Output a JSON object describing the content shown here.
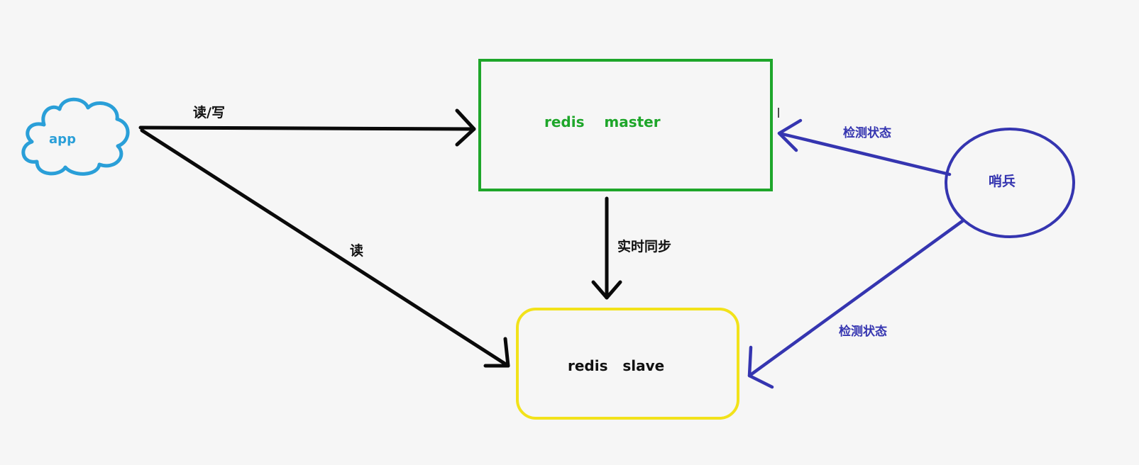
{
  "nodes": {
    "app": {
      "label": "app"
    },
    "master": {
      "label": "redis    master"
    },
    "slave": {
      "label": "redis   slave"
    },
    "sentinel": {
      "label": "哨兵"
    }
  },
  "edges": {
    "app_master": {
      "label": "读/写"
    },
    "app_slave": {
      "label": "读"
    },
    "master_slave": {
      "label": "实时同步"
    },
    "sentinel_master": {
      "label": "检测状态"
    },
    "sentinel_slave": {
      "label": "检测状态"
    }
  },
  "cursor": {
    "glyph": "I"
  },
  "colors": {
    "cloud": "#2a9fd8",
    "master": "#1ea62a",
    "slave": "#f2e21a",
    "sentinel": "#3535b0",
    "arrow": "#0a0a0a",
    "text": "#111111"
  }
}
